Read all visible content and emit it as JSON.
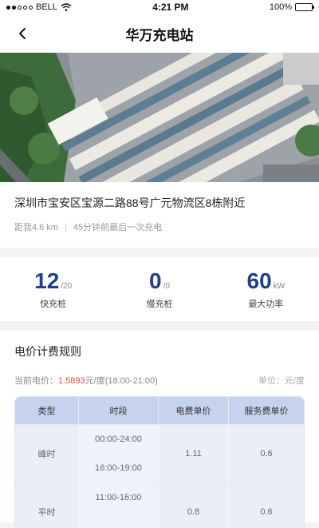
{
  "status_bar": {
    "carrier": "BELL",
    "time": "4:21 PM",
    "battery": "100%",
    "battery_level": 1.0
  },
  "nav": {
    "title": "华万充电站"
  },
  "station": {
    "address": "深圳市宝安区宝源二路88号广元物流区8栋附近",
    "distance": "距我4.6 km",
    "last_charge": "45分钟前最后一次充电"
  },
  "stats": {
    "fast": {
      "value": "12",
      "unit": "/20",
      "label": "快充桩"
    },
    "slow": {
      "value": "0",
      "unit": "/0",
      "label": "慢充桩"
    },
    "power": {
      "value": "60",
      "unit": "kW",
      "label": "最大功率"
    }
  },
  "pricing": {
    "title": "电价计费规则",
    "current_label": "当前电价：",
    "current_value": "1.5893",
    "current_suffix": "元/度(18:00-21:00)",
    "unit_hint": "单位：元/度",
    "headers": [
      "类型",
      "时段",
      "电费单价",
      "服务费单价"
    ],
    "rows": [
      {
        "type": "峰时",
        "times": [
          "00:00-24:00",
          "16:00-19:00"
        ],
        "elec": "1.11",
        "svc": "0.6"
      },
      {
        "type": "平时",
        "times": [
          "11:00-16:00",
          ""
        ],
        "elec": "0.8",
        "svc": "0.6"
      }
    ]
  },
  "colors": {
    "accent": "#1f3f8c",
    "price_highlight": "#e5533a",
    "table_header": "#c7d3ee"
  }
}
